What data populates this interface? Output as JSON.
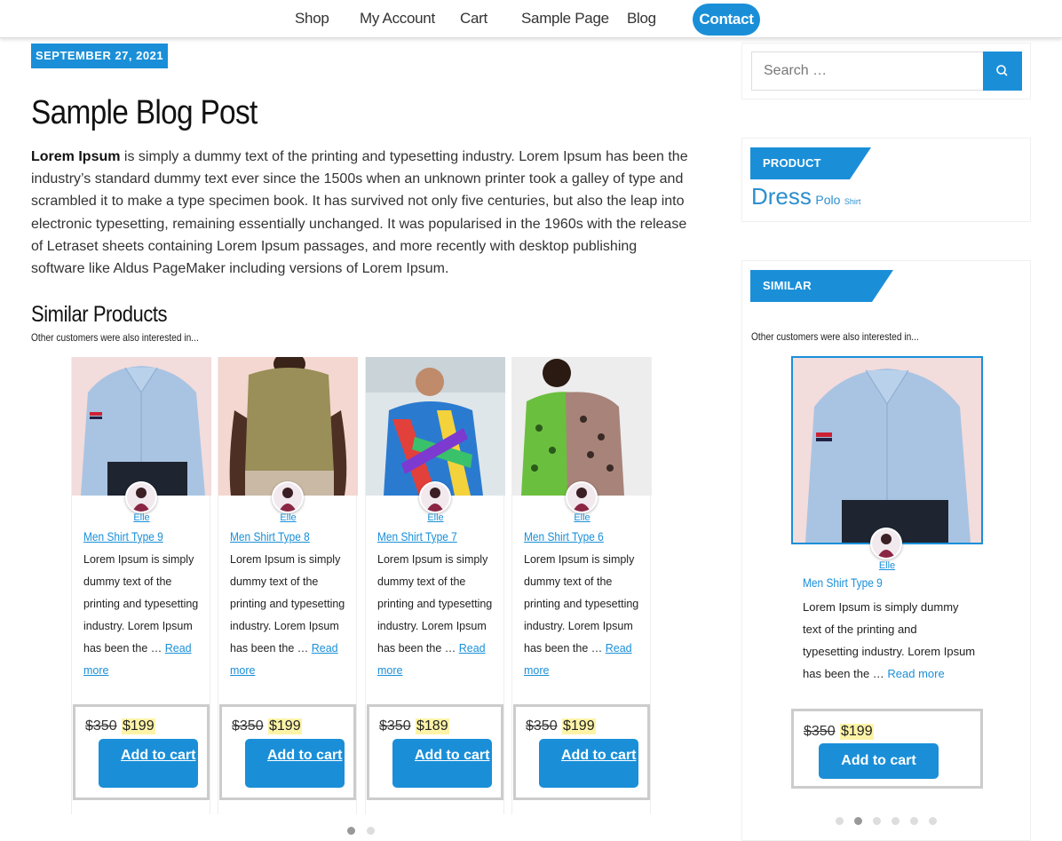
{
  "nav": {
    "items": [
      "Shop",
      "My Account",
      "Cart",
      "Sample Page",
      "Blog"
    ],
    "contact_label": "Contact"
  },
  "post": {
    "date": "SEPTEMBER 27, 2021",
    "title": "Sample Blog Post",
    "body_bold": "Lorem Ipsum",
    "body_rest": " is simply a dummy text of the printing and typesetting industry. Lorem Ipsum has been the industry’s standard dummy text ever since the 1500s when an unknown printer took a galley of type and scrambled it to make a type specimen book. It has survived not only five centuries, but also the leap into electronic typesetting, remaining essentially unchanged. It was popularised in the 1960s with the release of Letraset sheets containing Lorem Ipsum passages, and more recently with desktop publishing software like Aldus PageMaker including versions of Lorem Ipsum."
  },
  "similar": {
    "title": "Similar Products",
    "subtitle": "Other customers were also interested in...",
    "products": [
      {
        "author": "Elle",
        "name": "Men Shirt Type 9",
        "desc": "Lorem Ipsum is simply dummy text of the printing and typesetting industry. Lorem Ipsum has been the … ",
        "read_more": "Read more",
        "old_price": "$350",
        "new_price": "$199",
        "button": "Add to cart"
      },
      {
        "author": "Elle",
        "name": "Men Shirt Type 8",
        "desc": "Lorem Ipsum is simply dummy text of the printing and typesetting industry. Lorem Ipsum has been the … ",
        "read_more": "Read more",
        "old_price": "$350",
        "new_price": "$199",
        "button": "Add to cart"
      },
      {
        "author": "Elle",
        "name": "Men Shirt Type 7",
        "desc": "Lorem Ipsum is simply dummy text of the printing and typesetting industry. Lorem Ipsum has been the … ",
        "read_more": "Read more",
        "old_price": "$350",
        "new_price": "$189",
        "button": "Add to cart"
      },
      {
        "author": "Elle",
        "name": "Men Shirt Type 6",
        "desc": "Lorem Ipsum is simply dummy text of the printing and typesetting industry. Lorem Ipsum has been the … ",
        "read_more": "Read more",
        "old_price": "$350",
        "new_price": "$199",
        "button": "Add to cart"
      }
    ]
  },
  "sidebar": {
    "search_placeholder": "Search …",
    "tags_title": "PRODUCT TAGS",
    "tags": [
      "Dress",
      "Polo",
      "Shirt"
    ],
    "similar_title": "SIMILAR PRODUCTS",
    "similar_subtitle": "Other customers were also interested in...",
    "product": {
      "author": "Elle",
      "name": "Men Shirt Type 9",
      "desc": "Lorem Ipsum is simply dummy text of the printing and typesetting industry. Lorem Ipsum has been the … ",
      "read_more": "Read more",
      "old_price": "$350",
      "new_price": "$199",
      "button": "Add to cart"
    }
  },
  "colors": {
    "accent": "#1a8fd8",
    "price_highlight": "#fdf3a7"
  }
}
